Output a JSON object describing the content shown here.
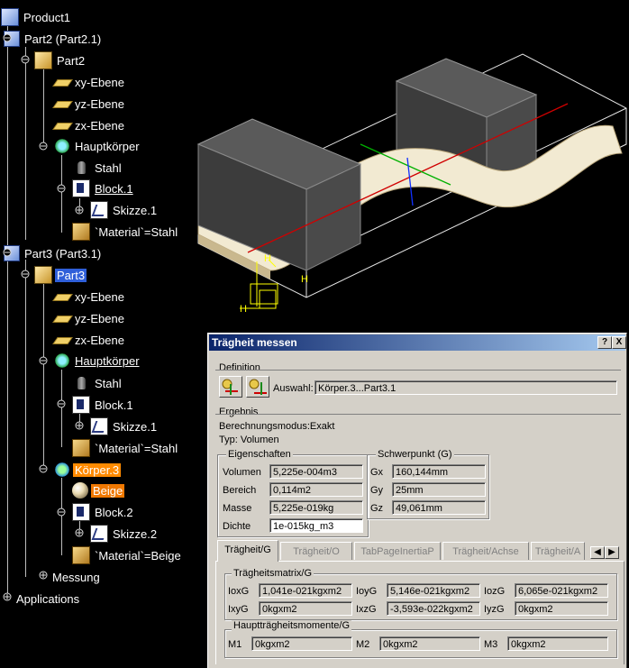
{
  "tree": {
    "nodes": [
      {
        "label": "Product1",
        "icon": "product-icon"
      },
      {
        "label": "Part2 (Part2.1)",
        "icon": "part-icon"
      },
      {
        "label": "Part2",
        "icon": "part-body-icon"
      },
      {
        "label": "xy-Ebene",
        "icon": "plane-icon"
      },
      {
        "label": "yz-Ebene",
        "icon": "plane-icon"
      },
      {
        "label": "zx-Ebene",
        "icon": "plane-icon"
      },
      {
        "label": "Hauptkörper",
        "icon": "body-icon"
      },
      {
        "label": "Stahl",
        "icon": "material-icon"
      },
      {
        "label": "Block.1",
        "icon": "pad-icon"
      },
      {
        "label": "Skizze.1",
        "icon": "sketch-icon"
      },
      {
        "label": "`Material`=Stahl",
        "icon": "material-param-icon"
      },
      {
        "label": "Part3 (Part3.1)",
        "icon": "part-icon"
      },
      {
        "label": "Part3",
        "icon": "part-body-icon"
      },
      {
        "label": "xy-Ebene",
        "icon": "plane-icon"
      },
      {
        "label": "yz-Ebene",
        "icon": "plane-icon"
      },
      {
        "label": "zx-Ebene",
        "icon": "plane-icon"
      },
      {
        "label": "Hauptkörper",
        "icon": "body-icon"
      },
      {
        "label": "Stahl",
        "icon": "material-icon"
      },
      {
        "label": "Block.1",
        "icon": "pad-icon"
      },
      {
        "label": "Skizze.1",
        "icon": "sketch-icon"
      },
      {
        "label": "`Material`=Stahl",
        "icon": "material-param-icon"
      },
      {
        "label": "Körper.3",
        "icon": "body-icon"
      },
      {
        "label": "Beige",
        "icon": "sphere-icon"
      },
      {
        "label": "Block.2",
        "icon": "pad-icon"
      },
      {
        "label": "Skizze.2",
        "icon": "sketch-icon"
      },
      {
        "label": "`Material`=Beige",
        "icon": "material-param-icon"
      },
      {
        "label": "Messung",
        "icon": "measure-icon"
      },
      {
        "label": "Applications",
        "icon": "applications-icon"
      }
    ]
  },
  "viewport": {
    "axis_labels": [
      "H",
      "H",
      "H"
    ]
  },
  "dialog": {
    "title": "Trägheit messen",
    "help_button": "?",
    "close_button": "X",
    "definition": {
      "group": "Definition",
      "selection_label": "Auswahl:",
      "selection_value": "Körper.3...Part3.1"
    },
    "result": {
      "group": "Ergebnis",
      "mode": "Berechnungsmodus:Exakt",
      "type": "Typ: Volumen"
    },
    "properties": {
      "group": "Eigenschaften",
      "rows": [
        {
          "label": "Volumen",
          "value": "5,225e-004m3"
        },
        {
          "label": "Bereich",
          "value": "0,114m2"
        },
        {
          "label": "Masse",
          "value": "5,225e-019kg"
        },
        {
          "label": "Dichte",
          "value": "1e-015kg_m3"
        }
      ]
    },
    "centroid": {
      "group": "Schwerpunkt (G)",
      "rows": [
        {
          "label": "Gx",
          "value": "160,144mm"
        },
        {
          "label": "Gy",
          "value": "25mm"
        },
        {
          "label": "Gz",
          "value": "49,061mm"
        }
      ]
    },
    "tabs": [
      "Trägheit/G",
      "Trägheit/O",
      "TabPageInertiaP",
      "Trägheit/Achse",
      "Trägheit/A"
    ],
    "matrix": {
      "group": "Trägheitsmatrix/G",
      "row1": [
        {
          "label": "IoxG",
          "value": "1,041e-021kgxm2"
        },
        {
          "label": "IoyG",
          "value": "5,146e-021kgxm2"
        },
        {
          "label": "IozG",
          "value": "6,065e-021kgxm2"
        }
      ],
      "row2": [
        {
          "label": "IxyG",
          "value": "0kgxm2"
        },
        {
          "label": "IxzG",
          "value": "-3,593e-022kgxm2"
        },
        {
          "label": "IyzG",
          "value": "0kgxm2"
        }
      ]
    },
    "principal": {
      "group": "Hauptträgheitsmomente/G",
      "rows": [
        {
          "label": "M1",
          "value": "0kgxm2"
        },
        {
          "label": "M2",
          "value": "0kgxm2"
        },
        {
          "label": "M3",
          "value": "0kgxm2"
        }
      ]
    }
  }
}
